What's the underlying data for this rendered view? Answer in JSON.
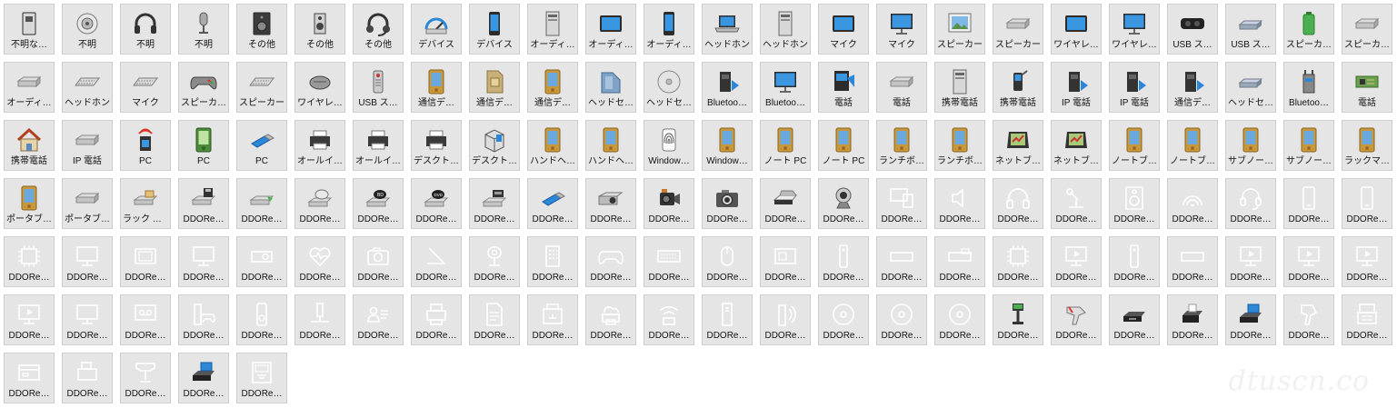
{
  "colors": {
    "tile_bg": "#e5e5e5",
    "tile_border": "#cdcdcd",
    "label": "#111111",
    "mono_icon": "#ffffff",
    "accent_blue": "#2b88d8"
  },
  "watermark": "dtuscn.co",
  "items": [
    {
      "label": "不明な…",
      "icon": "unknown-device-icon",
      "style": "color"
    },
    {
      "label": "不明",
      "icon": "speaker-icon",
      "style": "color"
    },
    {
      "label": "不明",
      "icon": "headphones-icon",
      "style": "color"
    },
    {
      "label": "不明",
      "icon": "microphone-icon",
      "style": "color"
    },
    {
      "label": "その他",
      "icon": "speaker-box-icon",
      "style": "color"
    },
    {
      "label": "その他",
      "icon": "speaker-small-icon",
      "style": "color"
    },
    {
      "label": "その他",
      "icon": "headset-icon",
      "style": "color"
    },
    {
      "label": "デバイス",
      "icon": "gauge-icon",
      "style": "color"
    },
    {
      "label": "デバイス",
      "icon": "phone-icon",
      "style": "color"
    },
    {
      "label": "オーディ…",
      "icon": "tower-icon",
      "style": "color"
    },
    {
      "label": "オーディ…",
      "icon": "tablet-icon",
      "style": "color"
    },
    {
      "label": "オーディ…",
      "icon": "phone-icon",
      "style": "color"
    },
    {
      "label": "ヘッドホン",
      "icon": "laptop-icon",
      "style": "color"
    },
    {
      "label": "ヘッドホン",
      "icon": "tower-icon",
      "style": "color"
    },
    {
      "label": "マイク",
      "icon": "tablet-icon",
      "style": "color"
    },
    {
      "label": "マイク",
      "icon": "monitor-icon",
      "style": "color"
    },
    {
      "label": "スピーカー",
      "icon": "picture-frame-icon",
      "style": "color"
    },
    {
      "label": "スピーカー",
      "icon": "media-box-icon",
      "style": "color"
    },
    {
      "label": "ワイヤレ…",
      "icon": "tablet-icon",
      "style": "color"
    },
    {
      "label": "ワイヤレ…",
      "icon": "monitor-icon",
      "style": "color"
    },
    {
      "label": "USB ス…",
      "icon": "vr-headset-icon",
      "style": "color"
    },
    {
      "label": "USB ス…",
      "icon": "usb-hub-icon",
      "style": "color"
    },
    {
      "label": "スピーカ…",
      "icon": "battery-icon",
      "style": "color"
    },
    {
      "label": "スピーカ…",
      "icon": "media-box-icon",
      "style": "color"
    },
    {
      "label": "オーディ…",
      "icon": "media-box-icon",
      "style": "color"
    },
    {
      "label": "ヘッドホン",
      "icon": "keyboard-icon",
      "style": "color"
    },
    {
      "label": "マイク",
      "icon": "keyboard-icon",
      "style": "color"
    },
    {
      "label": "スピーカ…",
      "icon": "gamepad-icon",
      "style": "color"
    },
    {
      "label": "スピーカー",
      "icon": "keyboard-icon",
      "style": "color"
    },
    {
      "label": "ワイヤレ…",
      "icon": "mouse-icon",
      "style": "color"
    },
    {
      "label": "USB ス…",
      "icon": "remote-icon",
      "style": "color"
    },
    {
      "label": "通信デ…",
      "icon": "pda-icon",
      "style": "color"
    },
    {
      "label": "通信デ…",
      "icon": "sim-card-icon",
      "style": "color"
    },
    {
      "label": "通信デ…",
      "icon": "pda-icon",
      "style": "color"
    },
    {
      "label": "ヘッドセ…",
      "icon": "folder-icon",
      "style": "color"
    },
    {
      "label": "ヘッドセ…",
      "icon": "disc-icon",
      "style": "color"
    },
    {
      "label": "Bluetoo…",
      "icon": "bluetooth-device-icon",
      "style": "color"
    },
    {
      "label": "Bluetoo…",
      "icon": "monitor-icon",
      "style": "color"
    },
    {
      "label": "電話",
      "icon": "media-center-icon",
      "style": "color"
    },
    {
      "label": "電話",
      "icon": "media-box-icon",
      "style": "color"
    },
    {
      "label": "携帯電話",
      "icon": "tower-icon",
      "style": "color"
    },
    {
      "label": "携帯電話",
      "icon": "mp3-player-icon",
      "style": "color"
    },
    {
      "label": "IP 電話",
      "icon": "bluetooth-device-icon",
      "style": "color"
    },
    {
      "label": "IP 電話",
      "icon": "bluetooth-device-icon",
      "style": "color"
    },
    {
      "label": "通信デ…",
      "icon": "bluetooth-device-icon",
      "style": "color"
    },
    {
      "label": "ヘッドセ…",
      "icon": "usb-hub-icon",
      "style": "color"
    },
    {
      "label": "Bluetoo…",
      "icon": "router-icon",
      "style": "color"
    },
    {
      "label": "電話",
      "icon": "circuit-board-icon",
      "style": "color"
    },
    {
      "label": "携帯電話",
      "icon": "home-icon",
      "style": "color"
    },
    {
      "label": "IP 電話",
      "icon": "media-box-icon",
      "style": "color"
    },
    {
      "label": "PC",
      "icon": "wifi-tower-icon",
      "style": "color"
    },
    {
      "label": "PC",
      "icon": "pda-green-icon",
      "style": "color"
    },
    {
      "label": "PC",
      "icon": "usb-stick-icon",
      "style": "color"
    },
    {
      "label": "オールイ…",
      "icon": "printer-icon",
      "style": "color"
    },
    {
      "label": "オールイ…",
      "icon": "printer-icon",
      "style": "color"
    },
    {
      "label": "デスクト…",
      "icon": "printer-icon",
      "style": "color"
    },
    {
      "label": "デスクト…",
      "icon": "box-icon",
      "style": "color"
    },
    {
      "label": "ハンドヘ…",
      "icon": "pda-icon",
      "style": "color"
    },
    {
      "label": "ハンドヘ…",
      "icon": "pda-icon",
      "style": "color"
    },
    {
      "label": "Window…",
      "icon": "fingerprint-icon",
      "style": "color"
    },
    {
      "label": "Window…",
      "icon": "pda-icon",
      "style": "color"
    },
    {
      "label": "ノート PC",
      "icon": "pda-icon",
      "style": "color"
    },
    {
      "label": "ノート PC",
      "icon": "pda-icon",
      "style": "color"
    },
    {
      "label": "ランチボ…",
      "icon": "pda-icon",
      "style": "color"
    },
    {
      "label": "ランチボ…",
      "icon": "pda-icon",
      "style": "color"
    },
    {
      "label": "ネットブック",
      "icon": "gps-icon",
      "style": "color"
    },
    {
      "label": "ネットブック",
      "icon": "gps-icon",
      "style": "color"
    },
    {
      "label": "ノートブ…",
      "icon": "pda-icon",
      "style": "color"
    },
    {
      "label": "ノートブ…",
      "icon": "pda-icon",
      "style": "color"
    },
    {
      "label": "サブノー…",
      "icon": "pda-icon",
      "style": "color"
    },
    {
      "label": "サブノー…",
      "icon": "pda-icon",
      "style": "color"
    },
    {
      "label": "ラックマ…",
      "icon": "pda-icon",
      "style": "color"
    },
    {
      "label": "ポータブ…",
      "icon": "pda-icon",
      "style": "color"
    },
    {
      "label": "ポータブ…",
      "icon": "media-box-icon",
      "style": "color"
    },
    {
      "label": "ラック マ…",
      "icon": "card-reader-icon",
      "style": "color"
    },
    {
      "label": "DDORe…",
      "icon": "floppy-drive-icon",
      "style": "color"
    },
    {
      "label": "DDORe…",
      "icon": "drive-green-icon",
      "style": "color"
    },
    {
      "label": "DDORe…",
      "icon": "cd-drive-icon",
      "style": "color"
    },
    {
      "label": "DDORe…",
      "icon": "bd-drive-icon",
      "style": "color"
    },
    {
      "label": "DDORe…",
      "icon": "dvd-drive-icon",
      "style": "color"
    },
    {
      "label": "DDORe…",
      "icon": "tape-drive-icon",
      "style": "color"
    },
    {
      "label": "DDORe…",
      "icon": "usb-stick-icon",
      "style": "color"
    },
    {
      "label": "DDORe…",
      "icon": "projector-icon",
      "style": "color"
    },
    {
      "label": "DDORe…",
      "icon": "video-camera-icon",
      "style": "color"
    },
    {
      "label": "DDORe…",
      "icon": "camera-icon",
      "style": "color"
    },
    {
      "label": "DDORe…",
      "icon": "scanner-icon",
      "style": "color"
    },
    {
      "label": "DDORe…",
      "icon": "webcam-icon",
      "style": "color"
    },
    {
      "label": "DDORe…",
      "icon": "devices-icon",
      "style": "mono"
    },
    {
      "label": "DDORe…",
      "icon": "speaker-icon",
      "style": "mono"
    },
    {
      "label": "DDORe…",
      "icon": "headphones-icon",
      "style": "mono"
    },
    {
      "label": "DDORe…",
      "icon": "microphone-icon",
      "style": "mono"
    },
    {
      "label": "DDORe…",
      "icon": "speaker-box-icon",
      "style": "mono"
    },
    {
      "label": "DDORe…",
      "icon": "wireless-icon",
      "style": "mono"
    },
    {
      "label": "DDORe…",
      "icon": "headset-icon",
      "style": "mono"
    },
    {
      "label": "DDORe…",
      "icon": "phone-icon",
      "style": "mono"
    },
    {
      "label": "DDORe…",
      "icon": "phone-icon",
      "style": "mono"
    },
    {
      "label": "DDORe…",
      "icon": "chip-icon",
      "style": "mono"
    },
    {
      "label": "DDORe…",
      "icon": "monitor-icon",
      "style": "mono"
    },
    {
      "label": "DDORe…",
      "icon": "tablet-icon",
      "style": "mono"
    },
    {
      "label": "DDORe…",
      "icon": "monitor-icon",
      "style": "mono"
    },
    {
      "label": "DDORe…",
      "icon": "projector-icon",
      "style": "mono"
    },
    {
      "label": "DDORe…",
      "icon": "heart-rate-icon",
      "style": "mono"
    },
    {
      "label": "DDORe…",
      "icon": "camera-icon",
      "style": "mono"
    },
    {
      "label": "DDORe…",
      "icon": "scanner-icon",
      "style": "mono"
    },
    {
      "label": "DDORe…",
      "icon": "webcam-icon",
      "style": "mono"
    },
    {
      "label": "DDORe…",
      "icon": "keypad-icon",
      "style": "mono"
    },
    {
      "label": "DDORe…",
      "icon": "gamepad-icon",
      "style": "mono"
    },
    {
      "label": "DDORe…",
      "icon": "keyboard-icon",
      "style": "mono"
    },
    {
      "label": "DDORe…",
      "icon": "mouse-icon",
      "style": "mono"
    },
    {
      "label": "DDORe…",
      "icon": "card-icon",
      "style": "mono"
    },
    {
      "label": "DDORe…",
      "icon": "remote-icon",
      "style": "mono"
    },
    {
      "label": "DDORe…",
      "icon": "media-box-icon",
      "style": "mono"
    },
    {
      "label": "DDORe…",
      "icon": "card-reader-icon",
      "style": "mono"
    },
    {
      "label": "DDORe…",
      "icon": "chip-icon",
      "style": "mono"
    },
    {
      "label": "DDORe…",
      "icon": "tv-play-icon",
      "style": "mono"
    },
    {
      "label": "DDORe…",
      "icon": "remote-icon",
      "style": "mono"
    },
    {
      "label": "DDORe…",
      "icon": "media-box-icon",
      "style": "mono"
    },
    {
      "label": "DDORe…",
      "icon": "tv-play-icon",
      "style": "mono"
    },
    {
      "label": "DDORe…",
      "icon": "tv-play-icon",
      "style": "mono"
    },
    {
      "label": "DDORe…",
      "icon": "tv-play-icon",
      "style": "mono"
    },
    {
      "label": "DDORe…",
      "icon": "tv-play-icon",
      "style": "mono"
    },
    {
      "label": "DDORe…",
      "icon": "monitor-icon",
      "style": "mono"
    },
    {
      "label": "DDORe…",
      "icon": "voicemail-icon",
      "style": "mono"
    },
    {
      "label": "DDORe…",
      "icon": "tower-gamepad-icon",
      "style": "mono"
    },
    {
      "label": "DDORe…",
      "icon": "mp3-player-icon",
      "style": "mono"
    },
    {
      "label": "DDORe…",
      "icon": "network-icon",
      "style": "mono"
    },
    {
      "label": "DDORe…",
      "icon": "contact-card-icon",
      "style": "mono"
    },
    {
      "label": "DDORe…",
      "icon": "printer-icon",
      "style": "mono"
    },
    {
      "label": "DDORe…",
      "icon": "document-icon",
      "style": "mono"
    },
    {
      "label": "DDORe…",
      "icon": "fax-icon",
      "style": "mono"
    },
    {
      "label": "DDORe…",
      "icon": "cloud-printer-icon",
      "style": "mono"
    },
    {
      "label": "DDORe…",
      "icon": "wifi-router-icon",
      "style": "mono"
    },
    {
      "label": "DDORe…",
      "icon": "tower-icon",
      "style": "mono"
    },
    {
      "label": "DDORe…",
      "icon": "tower-signal-icon",
      "style": "mono"
    },
    {
      "label": "DDORe…",
      "icon": "disc-icon",
      "style": "mono"
    },
    {
      "label": "DDORe…",
      "icon": "disc-icon",
      "style": "mono"
    },
    {
      "label": "DDORe…",
      "icon": "disc-icon",
      "style": "mono"
    },
    {
      "label": "DDORe…",
      "icon": "pole-display-icon",
      "style": "color"
    },
    {
      "label": "DDORe…",
      "icon": "barcode-scanner-icon",
      "style": "color"
    },
    {
      "label": "DDORe…",
      "icon": "cash-drawer-icon",
      "style": "color"
    },
    {
      "label": "DDORe…",
      "icon": "receipt-printer-icon",
      "style": "color"
    },
    {
      "label": "DDORe…",
      "icon": "card-swipe-icon",
      "style": "color"
    },
    {
      "label": "DDORe…",
      "icon": "barcode-scanner-icon",
      "style": "mono"
    },
    {
      "label": "DDORe…",
      "icon": "cash-register-icon",
      "style": "mono"
    },
    {
      "label": "DDORe…",
      "icon": "card-swipe-icon",
      "style": "mono"
    },
    {
      "label": "DDORe…",
      "icon": "receipt-printer-icon",
      "style": "mono"
    },
    {
      "label": "DDORe…",
      "icon": "pole-display-icon",
      "style": "mono"
    },
    {
      "label": "DDORe…",
      "icon": "card-swipe-icon",
      "style": "color"
    },
    {
      "label": "DDORe…",
      "icon": "atm-icon",
      "style": "mono"
    }
  ]
}
